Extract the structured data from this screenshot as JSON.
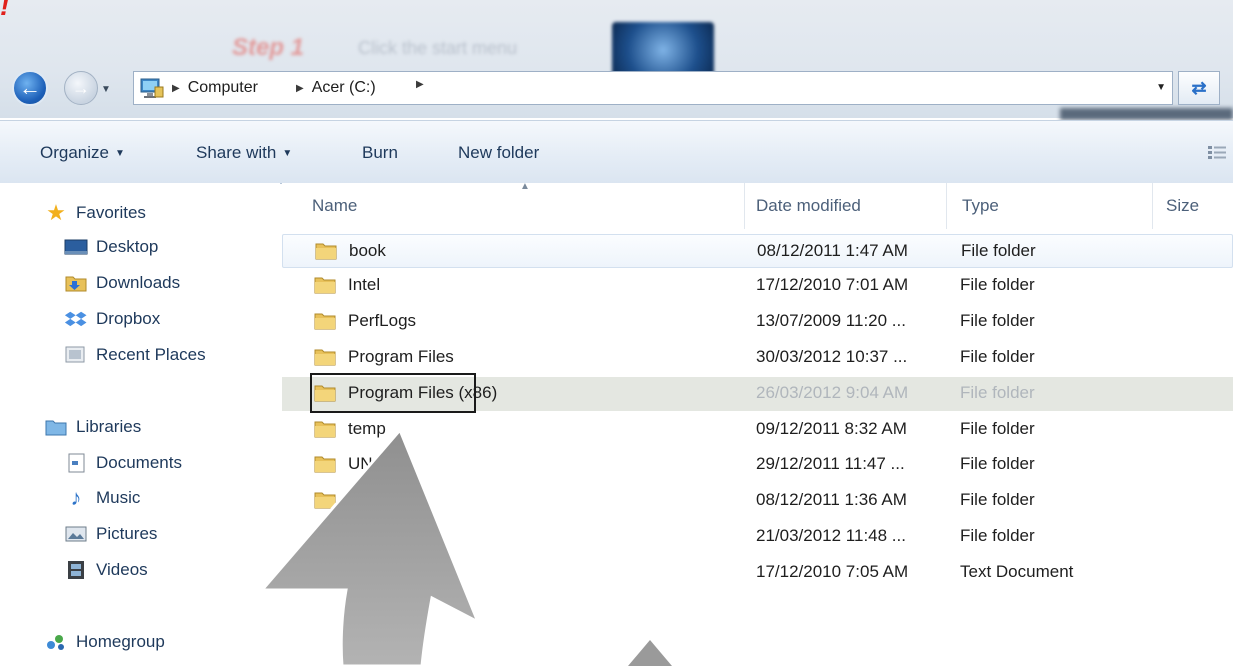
{
  "address_bar": {
    "crumbs": [
      "Computer",
      "Acer (C:)"
    ]
  },
  "command_bar": {
    "organize": "Organize",
    "share_with": "Share with",
    "burn": "Burn",
    "new_folder": "New folder"
  },
  "nav_pane": {
    "favorites": {
      "label": "Favorites",
      "items": [
        "Desktop",
        "Downloads",
        "Dropbox",
        "Recent Places"
      ]
    },
    "libraries": {
      "label": "Libraries",
      "items": [
        "Documents",
        "Music",
        "Pictures",
        "Videos"
      ]
    },
    "homegroup": "Homegroup"
  },
  "file_list": {
    "columns": {
      "name": "Name",
      "date_modified": "Date modified",
      "type": "Type",
      "size": "Size"
    },
    "rows": [
      {
        "name": "book",
        "date": "08/12/2011 1:47 AM",
        "type": "File folder"
      },
      {
        "name": "Intel",
        "date": "17/12/2010 7:01 AM",
        "type": "File folder"
      },
      {
        "name": "PerfLogs",
        "date": "13/07/2009 11:20 ...",
        "type": "File folder"
      },
      {
        "name": "Program Files",
        "date": "30/03/2012 10:37 ...",
        "type": "File folder"
      },
      {
        "name": "Program Files (x86)",
        "date": "26/03/2012 9:04 AM",
        "type": "File folder"
      },
      {
        "name": "temp",
        "date": "09/12/2011 8:32 AM",
        "type": "File folder"
      },
      {
        "name": "UN",
        "date": "29/12/2011 11:47 ...",
        "type": "File folder"
      },
      {
        "name": "U",
        "date": "08/12/2011 1:36 AM",
        "type": "File folder"
      },
      {
        "name": "s",
        "date": "21/03/2012 11:48 ...",
        "type": "File folder"
      },
      {
        "name": "",
        "date": "17/12/2010 7:05 AM",
        "type": "Text Document"
      }
    ]
  },
  "tutorial_overlay": {
    "step_label": "Step 1",
    "step_text": "Click the start menu"
  },
  "colors": {
    "accent": "#1e395b",
    "selected_row": "#e4e7e1",
    "annotation_red": "#e0201b"
  }
}
